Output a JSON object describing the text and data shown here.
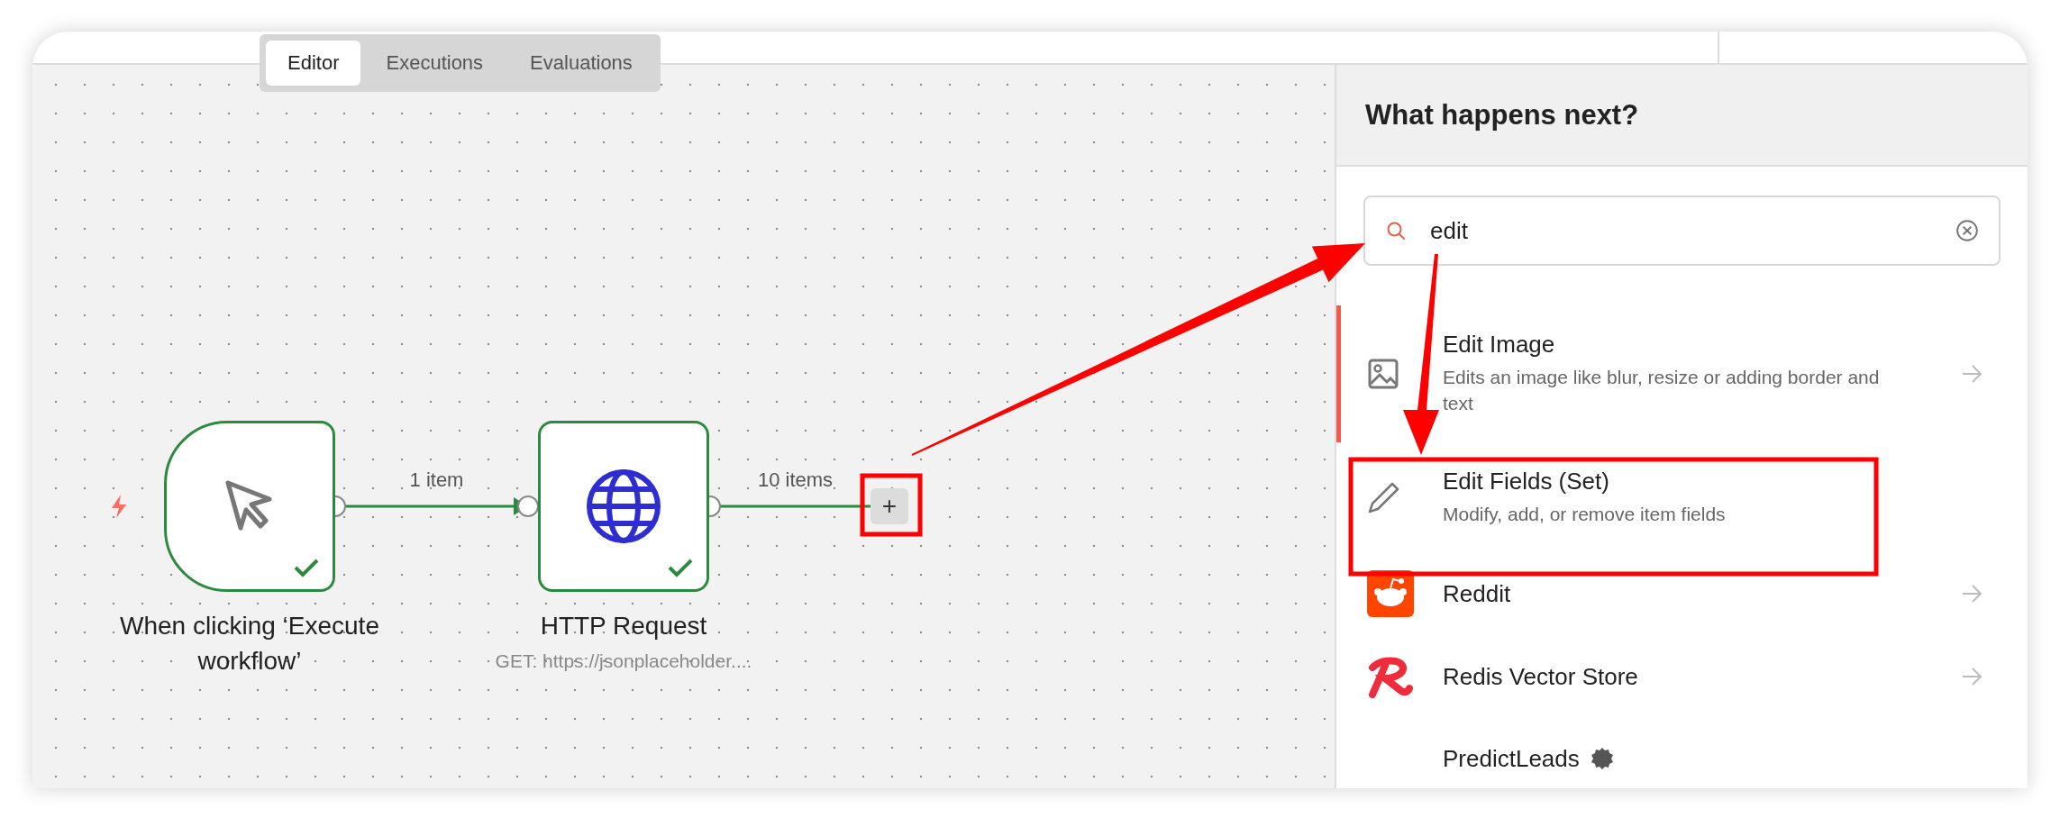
{
  "tabs": [
    {
      "label": "Editor",
      "selected": true
    },
    {
      "label": "Executions",
      "selected": false
    },
    {
      "label": "Evaluations",
      "selected": false
    }
  ],
  "canvas": {
    "nodes": [
      {
        "kind": "trigger",
        "title": "When clicking ‘Execute workflow’",
        "success": true
      },
      {
        "kind": "http",
        "title": "HTTP Request",
        "subtitle": "GET: https://jsonplaceholder....",
        "success": true
      }
    ],
    "connections": [
      {
        "label": "1 item"
      },
      {
        "label": "10 items"
      }
    ],
    "add_button": {
      "label": "+"
    }
  },
  "panel": {
    "title": "What happens next?",
    "search": {
      "value": "edit"
    },
    "results": [
      {
        "kind": "image",
        "title": "Edit Image",
        "description": "Edits an image like blur, resize or adding border and text",
        "selected": true,
        "show_arrow": true
      },
      {
        "kind": "pencil",
        "title": "Edit Fields (Set)",
        "description": "Modify, add, or remove item fields",
        "selected": false,
        "show_arrow": false
      },
      {
        "kind": "reddit",
        "title": "Reddit",
        "selected": false,
        "show_arrow": true
      },
      {
        "kind": "redis",
        "title": "Redis Vector Store",
        "selected": false,
        "show_arrow": true
      },
      {
        "kind": "verified",
        "title": "PredictLeads",
        "selected": false,
        "show_arrow": false
      }
    ]
  }
}
